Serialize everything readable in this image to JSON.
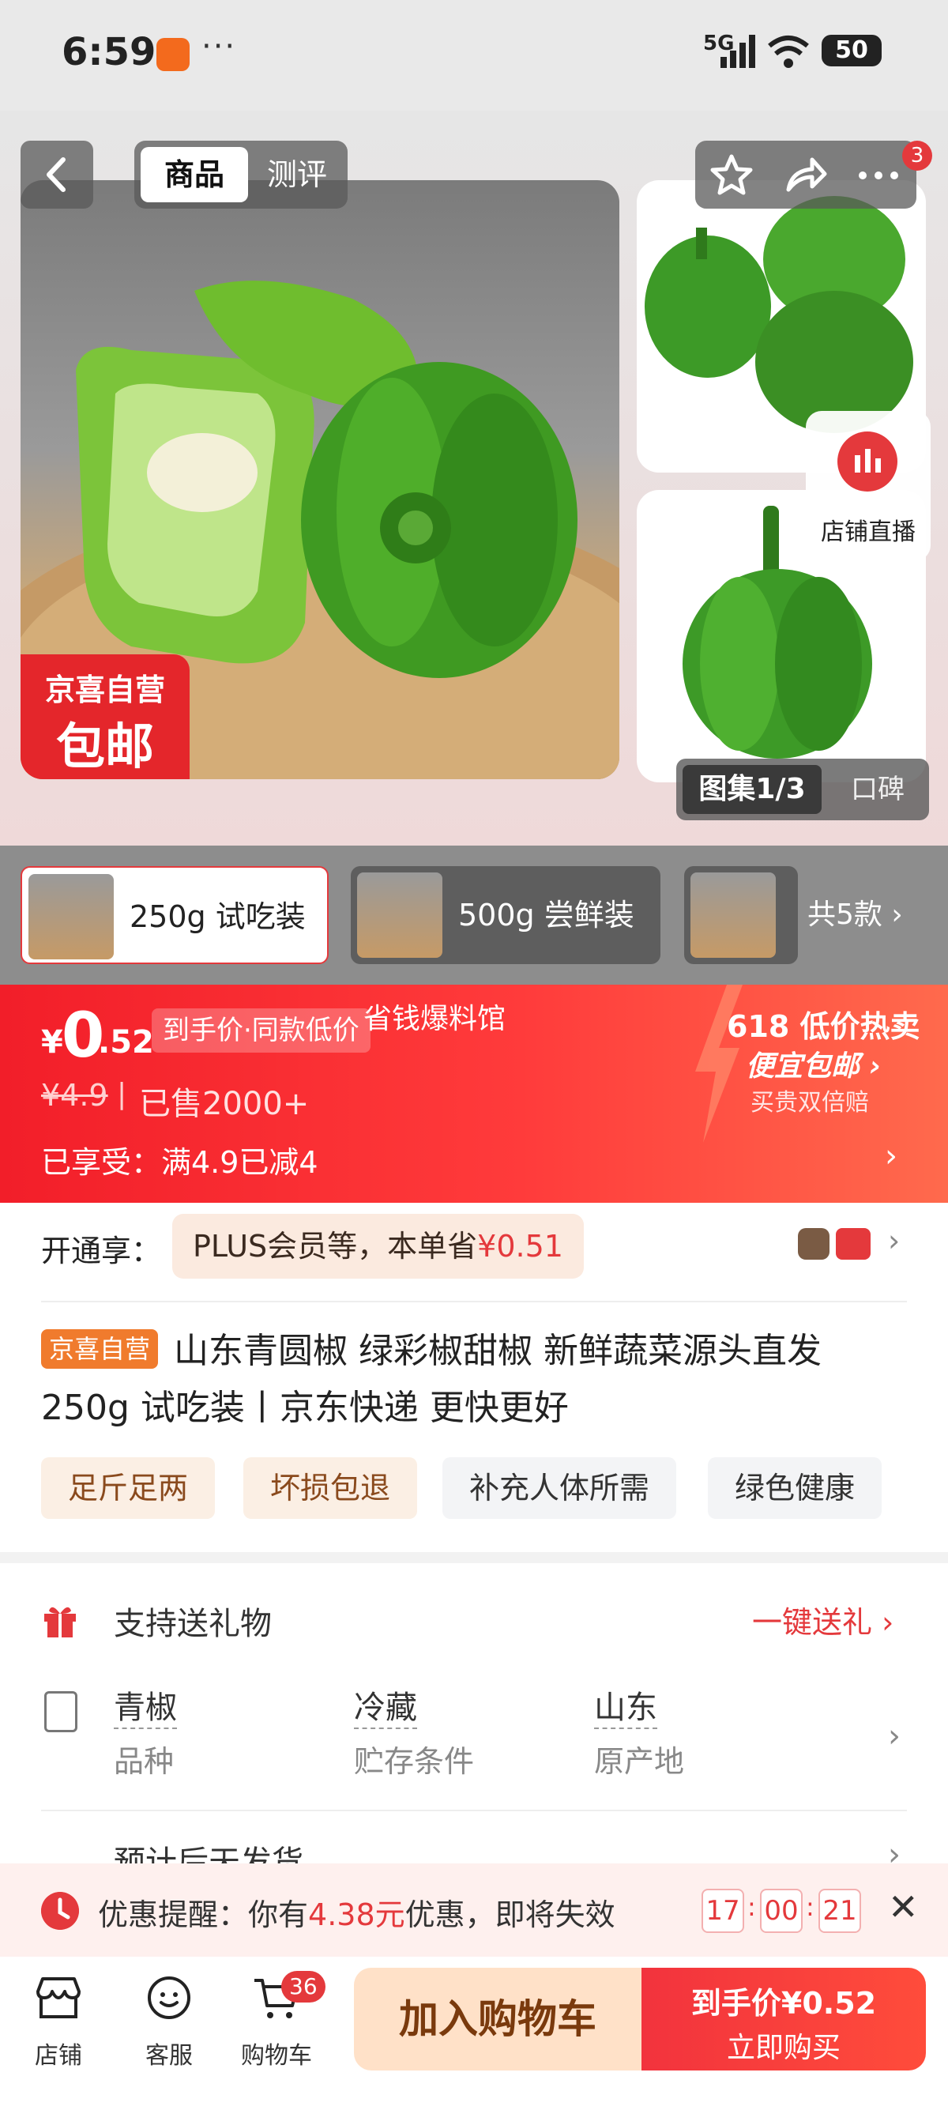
{
  "status_bar": {
    "time": "6:59",
    "dots": "···",
    "network": "5G",
    "battery": "50"
  },
  "top_nav": {
    "tab_goods": "商品",
    "tab_review": "测评",
    "notification_count": "3"
  },
  "gallery": {
    "badge_line1": "京喜自营",
    "badge_line2": "包邮",
    "counter": "图集1/3",
    "review_tab": "口碑",
    "live_label": "店铺直播"
  },
  "variants": {
    "items": [
      {
        "label": "250g 试吃装"
      },
      {
        "label": "500g 尝鲜装"
      },
      {
        "label": ""
      }
    ],
    "total": "共5款 ›"
  },
  "price": {
    "currency": "¥",
    "integer": "0",
    "decimal": ".52",
    "tag": "到手价·同款低价",
    "watermark": "省钱爆料馆",
    "original": "¥4.9",
    "separator": "|",
    "sold": "已售2000+",
    "discount": "已享受：满4.9已减4",
    "promo_title": "618 低价热卖",
    "promo_sub": "便宜包邮 ›",
    "promo_note": "买贵双倍赔"
  },
  "plus": {
    "lead": "开通享：",
    "text": "PLUS会员等，本单省",
    "amount": "¥0.51"
  },
  "title": {
    "badge": "京喜自营",
    "text": "山东青圆椒 绿彩椒甜椒 新鲜蔬菜源头直发 250g 试吃装丨京东快递 更快更好",
    "tags": [
      "足斤足两",
      "坏损包退",
      "补充人体所需",
      "绿色健康"
    ]
  },
  "info": {
    "gift_label": "支持送礼物",
    "gift_link": "一键送礼 ›",
    "specs": [
      {
        "value": "青椒",
        "key": "品种"
      },
      {
        "value": "冷藏",
        "key": "贮存条件"
      },
      {
        "value": "山东",
        "key": "原产地"
      }
    ],
    "shipping": "预计后天发货"
  },
  "coupon": {
    "prefix": "优惠提醒：你有",
    "amount": "4.38元",
    "suffix": "优惠，即将失效",
    "timer": [
      "17",
      "00",
      "21"
    ]
  },
  "bottom": {
    "store": "店铺",
    "service": "客服",
    "cart": "购物车",
    "cart_count": "36",
    "add_cart": "加入购物车",
    "buy_line1": "到手价¥0.52",
    "buy_line2": "立即购买"
  },
  "colors": {
    "accent": "#e4393c",
    "brand_orange": "#f07b2d"
  }
}
